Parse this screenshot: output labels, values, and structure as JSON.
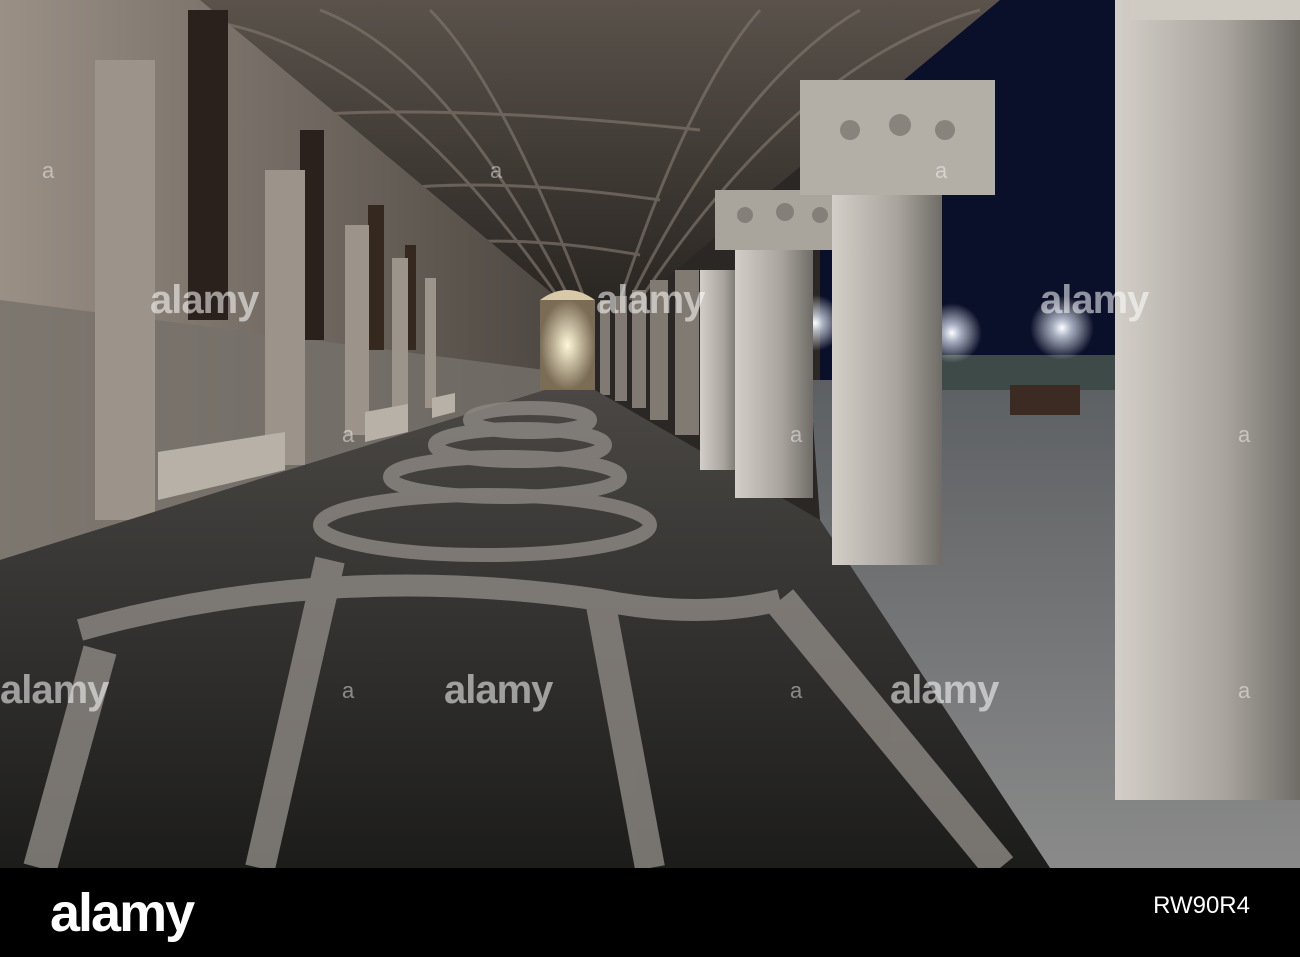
{
  "watermark": {
    "text": "alamy",
    "alt_text": "a"
  },
  "footer": {
    "brand": "alamy",
    "image_id": "RW90R4",
    "meta": ""
  },
  "colors": {
    "sky": "#0a0f2a",
    "floor_dark": "#232321",
    "floor_light": "#9a9590",
    "column": "#b8b4ad",
    "wall": "#8f857a"
  }
}
